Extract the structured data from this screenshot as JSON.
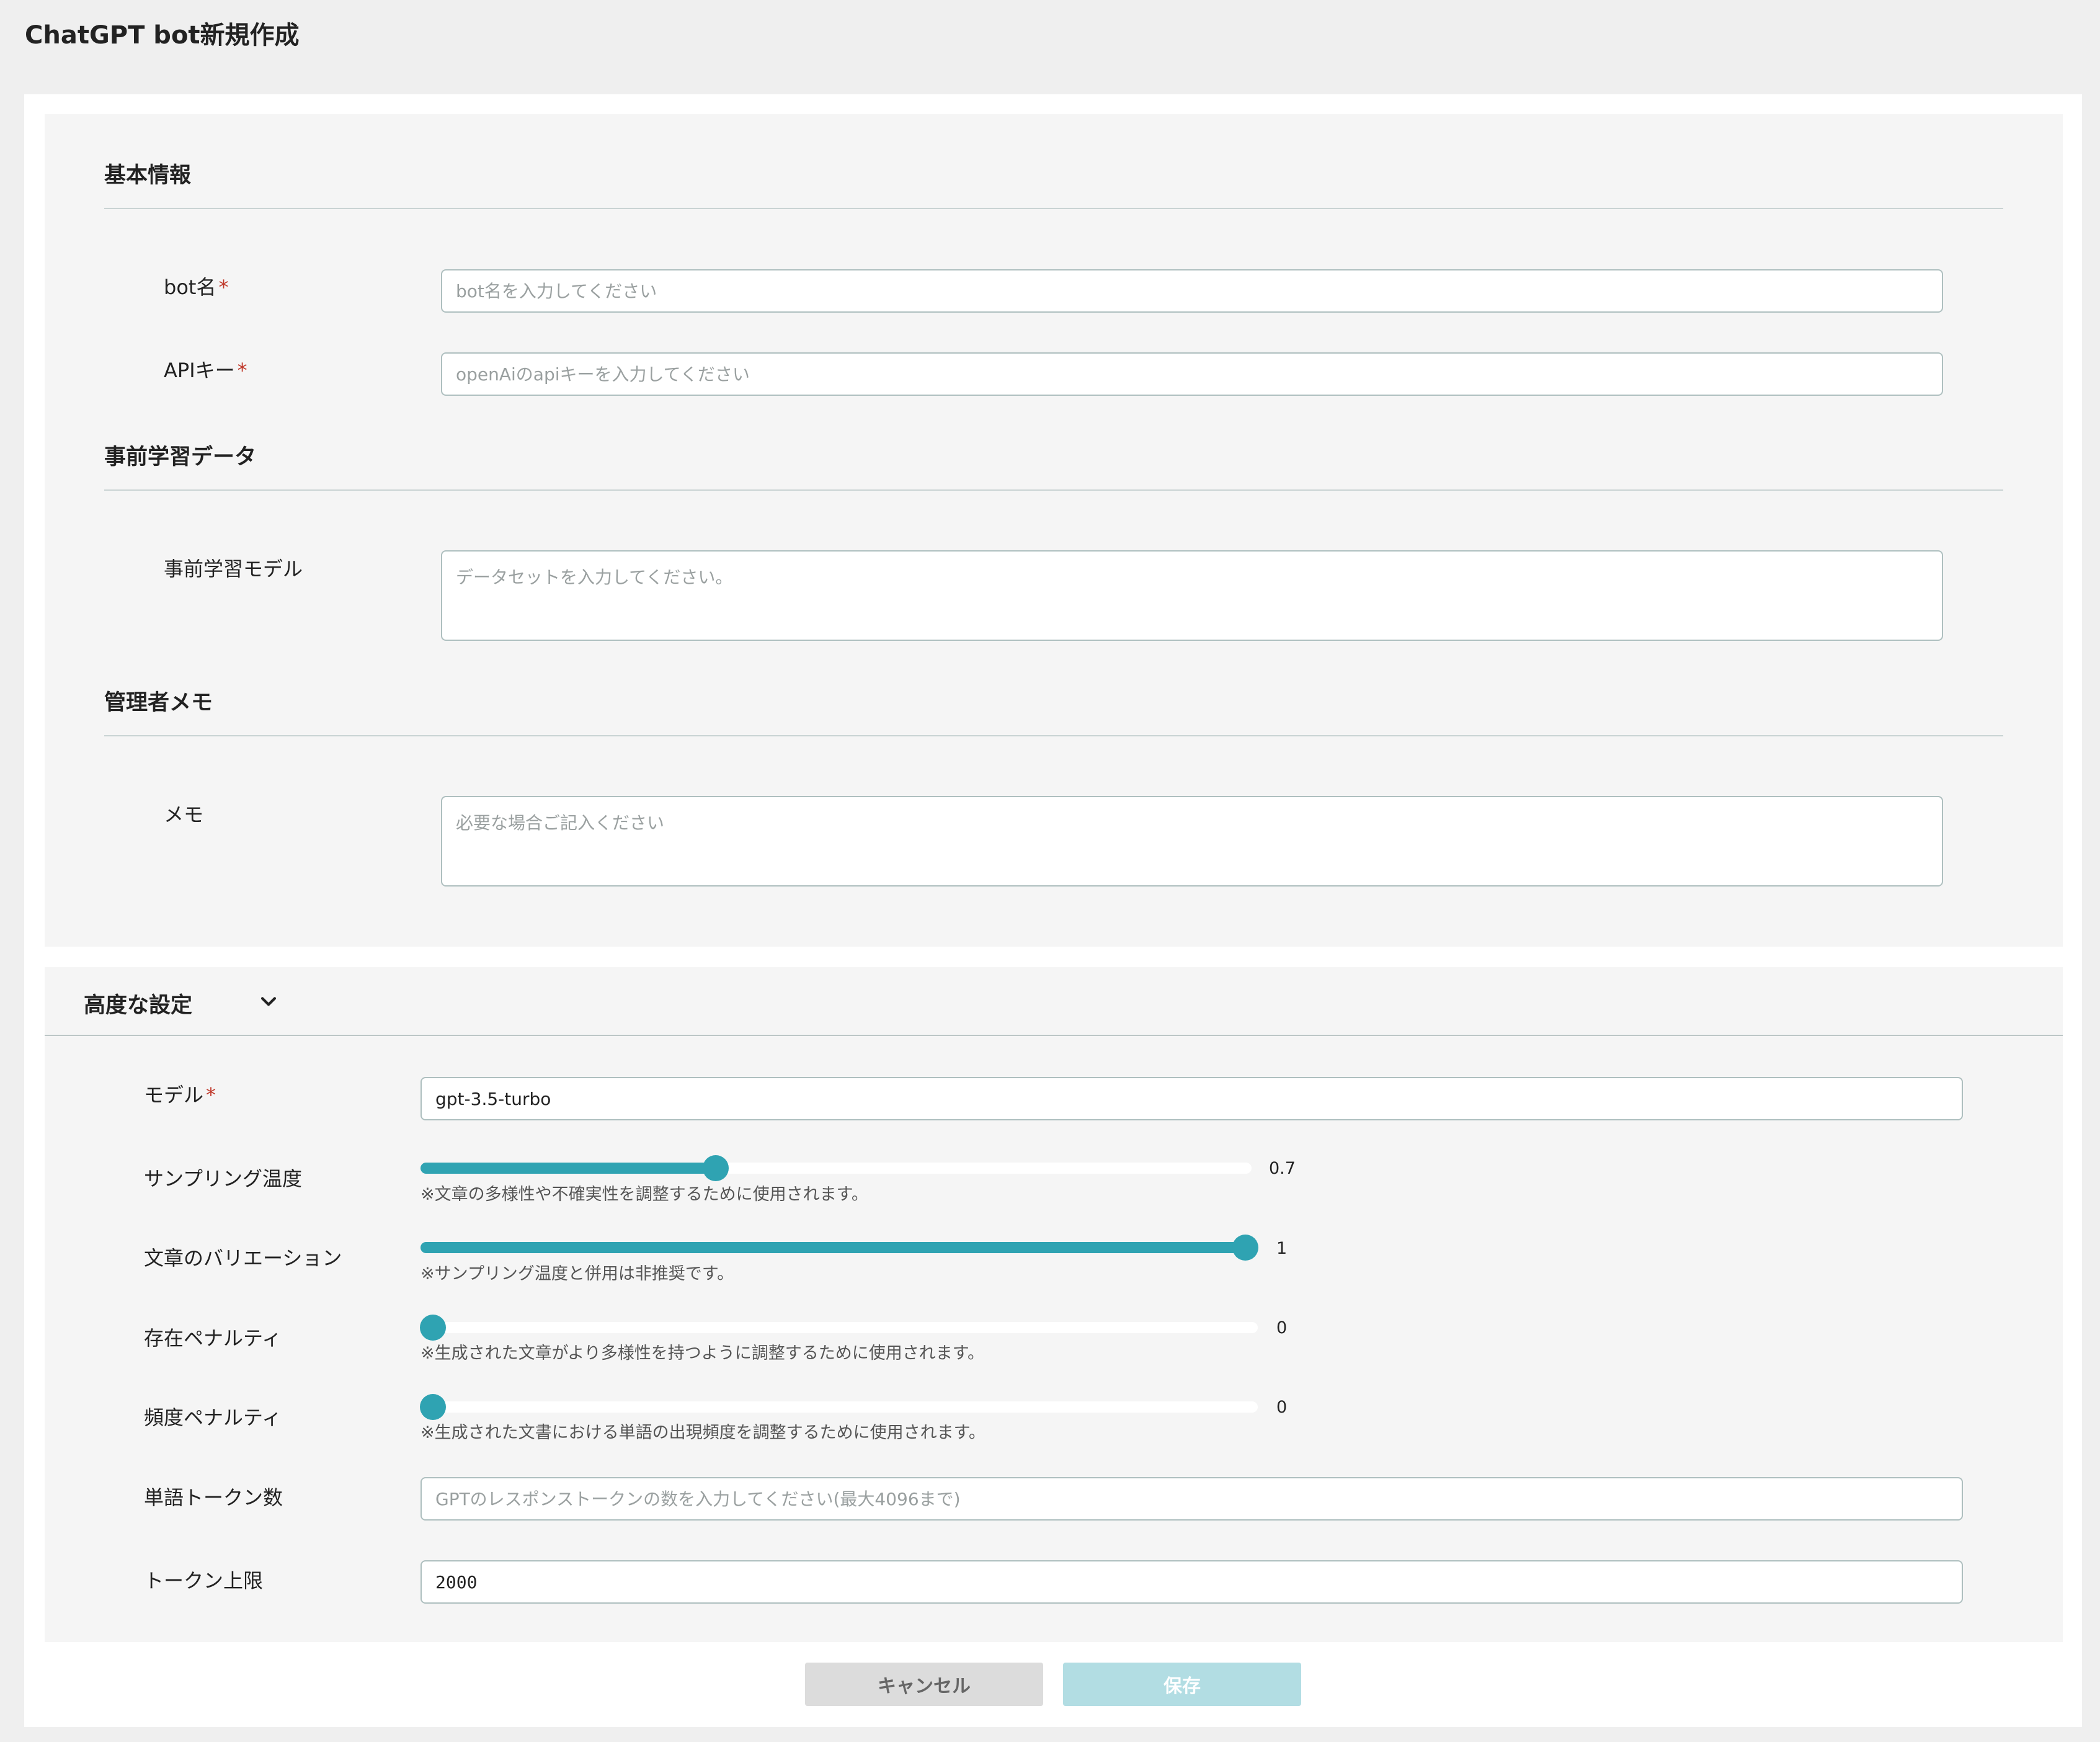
{
  "page": {
    "title": "ChatGPT bot新規作成"
  },
  "basic_info": {
    "section_title": "基本情報",
    "bot_name": {
      "label": "bot名",
      "required_mark": "*",
      "placeholder": "bot名を入力してください"
    },
    "api_key": {
      "label": "APIキー",
      "required_mark": "*",
      "placeholder": "openAiのapiキーを入力してください"
    }
  },
  "pretraining": {
    "section_title": "事前学習データ",
    "model": {
      "label": "事前学習モデル",
      "placeholder": "データセットを入力してください。"
    }
  },
  "admin_memo": {
    "section_title": "管理者メモ",
    "memo": {
      "label": "メモ",
      "placeholder": "必要な場合ご記入ください"
    }
  },
  "advanced": {
    "title": "高度な設定",
    "model": {
      "label": "モデル",
      "required_mark": "*",
      "value": "gpt-3.5-turbo"
    },
    "sampling_temperature": {
      "label": "サンプリング温度",
      "value": "0.7",
      "fraction": 0.355,
      "help": "※文章の多様性や不確実性を調整するために使用されます。"
    },
    "text_variation": {
      "label": "文章のバリエーション",
      "value": "1",
      "fraction": 1.0,
      "help": "※サンプリング温度と併用は非推奨です。"
    },
    "presence_penalty": {
      "label": "存在ペナルティ",
      "value": "0",
      "fraction": 0.0,
      "help": "※生成された文章がより多様性を持つように調整するために使用されます。"
    },
    "frequency_penalty": {
      "label": "頻度ペナルティ",
      "value": "0",
      "fraction": 0.0,
      "help": "※生成された文書における単語の出現頻度を調整するために使用されます。"
    },
    "word_tokens": {
      "label": "単語トークン数",
      "placeholder": "GPTのレスポンストークンの数を入力してください(最大4096まで)"
    },
    "token_limit": {
      "label": "トークン上限",
      "value": "2000"
    }
  },
  "buttons": {
    "cancel": "キャンセル",
    "save": "保存"
  },
  "colors": {
    "accent": "#2fa3b2",
    "save_disabled": "#b2dde3",
    "required": "#c0392b"
  }
}
